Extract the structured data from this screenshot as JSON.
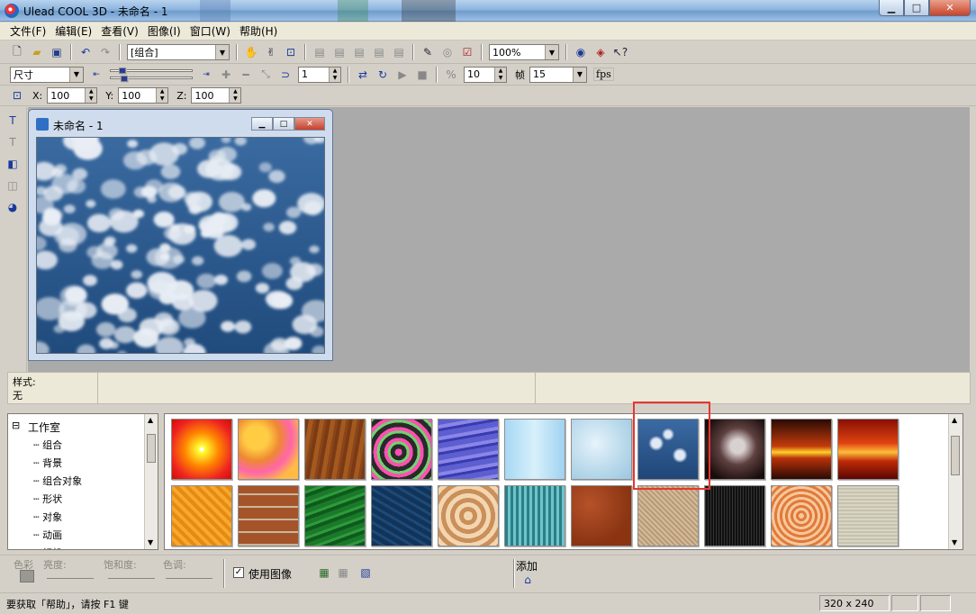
{
  "window": {
    "title": "Ulead COOL 3D - 未命名 - 1"
  },
  "menu": [
    "文件(F)",
    "编辑(E)",
    "查看(V)",
    "图像(I)",
    "窗口(W)",
    "帮助(H)"
  ],
  "toolbar1": {
    "object_combo": "[组合]",
    "zoom_combo": "100%"
  },
  "toolbar2": {
    "size_combo": "尺寸",
    "frame_value": "1",
    "value_10": "10",
    "frames_label": "帧",
    "fps_value": "15",
    "fps_label": "fps"
  },
  "toolbar3": {
    "x_label": "X:",
    "x_value": "100",
    "y_label": "Y:",
    "y_value": "100",
    "z_label": "Z:",
    "z_value": "100"
  },
  "child_window": {
    "title": "未命名 - 1"
  },
  "style_panel": {
    "label": "样式:",
    "value": "无"
  },
  "tree": {
    "root": "工作室",
    "items": [
      "组合",
      "背景",
      "组合对象",
      "形状",
      "对象",
      "动画",
      "相机"
    ]
  },
  "adjust": {
    "color_label": "色彩",
    "brightness_label": "亮度:",
    "saturation_label": "饱和度:",
    "hue_label": "色调:",
    "use_image_label": "使用图像",
    "use_image_checked": true,
    "add_label": "添加"
  },
  "status": {
    "help_text": "要获取「帮助」，请按 F1 键",
    "size": "320 x 240"
  },
  "colors": {
    "highlight": "#e8362e",
    "workspace": "#abaaaa",
    "chrome": "#d4d0c8"
  }
}
